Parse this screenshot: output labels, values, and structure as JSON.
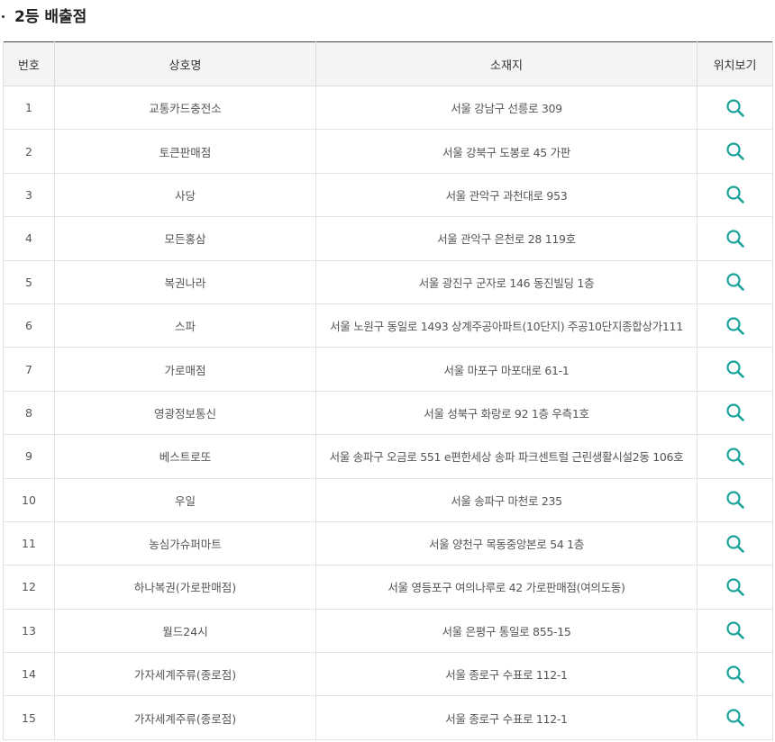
{
  "section": {
    "title": "2등 배출점"
  },
  "table": {
    "headers": {
      "no": "번호",
      "name": "상호명",
      "address": "소재지",
      "location": "위치보기"
    },
    "rows": [
      {
        "no": "1",
        "name": "교통카드충전소",
        "address": "서울 강남구 선릉로 309"
      },
      {
        "no": "2",
        "name": "토큰판매점",
        "address": "서울 강북구 도봉로 45 가판"
      },
      {
        "no": "3",
        "name": "사당",
        "address": "서울 관악구 과천대로 953"
      },
      {
        "no": "4",
        "name": "모든홍삼",
        "address": "서울 관악구 은천로 28 119호"
      },
      {
        "no": "5",
        "name": "복권나라",
        "address": "서울 광진구 군자로 146 동진빌딩 1층"
      },
      {
        "no": "6",
        "name": "스파",
        "address": "서울 노원구 동일로 1493 상계주공아파트(10단지) 주공10단지종합상가111"
      },
      {
        "no": "7",
        "name": "가로매점",
        "address": "서울 마포구 마포대로 61-1"
      },
      {
        "no": "8",
        "name": "영광정보통신",
        "address": "서울 성북구 화랑로 92 1층 우측1호"
      },
      {
        "no": "9",
        "name": "베스트로또",
        "address": "서울 송파구 오금로 551 e편한세상 송파 파크센트럴 근린생활시설2동 106호"
      },
      {
        "no": "10",
        "name": "우일",
        "address": "서울 송파구 마천로 235"
      },
      {
        "no": "11",
        "name": "농심가슈퍼마트",
        "address": "서울 양천구 목동중앙본로 54 1층"
      },
      {
        "no": "12",
        "name": "하나복권(가로판매점)",
        "address": "서울 영등포구 여의나루로 42 가로판매점(여의도동)"
      },
      {
        "no": "13",
        "name": "월드24시",
        "address": "서울 은평구 통일로 855-15"
      },
      {
        "no": "14",
        "name": "가자세계주류(종로점)",
        "address": "서울 종로구 수표로 112-1"
      },
      {
        "no": "15",
        "name": "가자세계주류(종로점)",
        "address": "서울 종로구 수표로 112-1"
      }
    ],
    "location_icon": "search-icon",
    "icon_color": "#1aa39a"
  }
}
